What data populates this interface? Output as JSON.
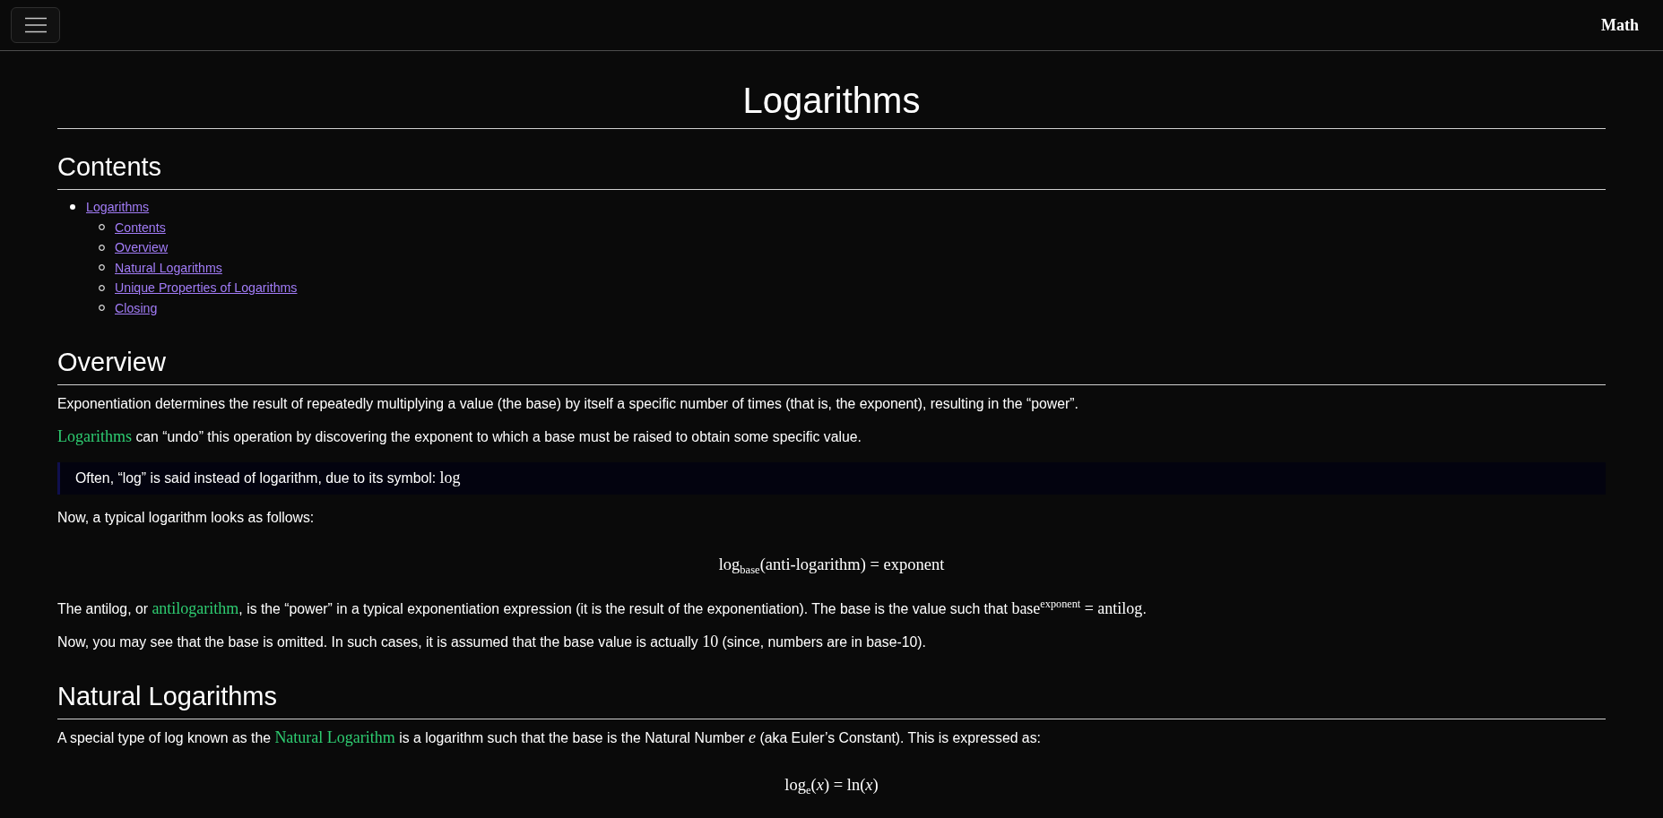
{
  "navbar": {
    "brand": "Math"
  },
  "title": "Logarithms",
  "contents": {
    "heading": "Contents",
    "items": [
      {
        "label": "Logarithms",
        "children": [
          {
            "label": "Contents"
          },
          {
            "label": "Overview"
          },
          {
            "label": "Natural Logarithms"
          },
          {
            "label": "Unique Properties of Logarithms"
          },
          {
            "label": "Closing"
          }
        ]
      }
    ]
  },
  "sections": [
    {
      "heading": "Overview",
      "blocks": [
        {
          "kind": "paragraph",
          "parts": [
            {
              "kind": "text",
              "text": "Exponentiation determines the result of repeatedly multiplying a value (the base) by itself a specific number of times (that is, the exponent), resulting in the “power”."
            }
          ]
        },
        {
          "kind": "paragraph",
          "parts": [
            {
              "kind": "term",
              "text": "Logarithms"
            },
            {
              "kind": "text",
              "text": " can “undo” this operation by discovering the exponent to which a base must be raised to obtain some specific value."
            }
          ]
        },
        {
          "kind": "note",
          "parts": [
            {
              "kind": "text",
              "text": "Often, “log” is said instead of logarithm, due to its symbol: "
            },
            {
              "kind": "math",
              "text": "log"
            }
          ]
        },
        {
          "kind": "paragraph",
          "parts": [
            {
              "kind": "text",
              "text": "Now, a typical logarithm looks as follows:"
            }
          ]
        },
        {
          "kind": "equation",
          "text": "log$_{base}$(anti-logarithm) = exponent"
        },
        {
          "kind": "paragraph",
          "parts": [
            {
              "kind": "text",
              "text": "The antilog, or "
            },
            {
              "kind": "term",
              "text": "antilogarithm"
            },
            {
              "kind": "text",
              "text": ", is the “power” in a typical exponentiation expression (it is the result of the exponentiation). The base is the value such that "
            },
            {
              "kind": "math",
              "text": "base$^{exponent}$ = antilog"
            },
            {
              "kind": "text",
              "text": "."
            }
          ]
        },
        {
          "kind": "paragraph",
          "parts": [
            {
              "kind": "text",
              "text": "Now, you may see that the base is omitted. In such cases, it is assumed that the base value is actually "
            },
            {
              "kind": "math",
              "text": "10"
            },
            {
              "kind": "text",
              "text": " (since, numbers are in base-10)."
            }
          ]
        }
      ]
    },
    {
      "heading": "Natural Logarithms",
      "blocks": [
        {
          "kind": "paragraph",
          "parts": [
            {
              "kind": "text",
              "text": "A special type of log known as the "
            },
            {
              "kind": "term",
              "text": "Natural Logarithm"
            },
            {
              "kind": "text",
              "text": " is a logarithm such that the base is the Natural Number "
            },
            {
              "kind": "math",
              "text": "*e*"
            },
            {
              "kind": "text",
              "text": " (aka Euler’s Constant). This is expressed as:"
            }
          ]
        },
        {
          "kind": "equation",
          "text": "log$_{e}$(*x*) = ln(*x*)"
        }
      ]
    }
  ]
}
